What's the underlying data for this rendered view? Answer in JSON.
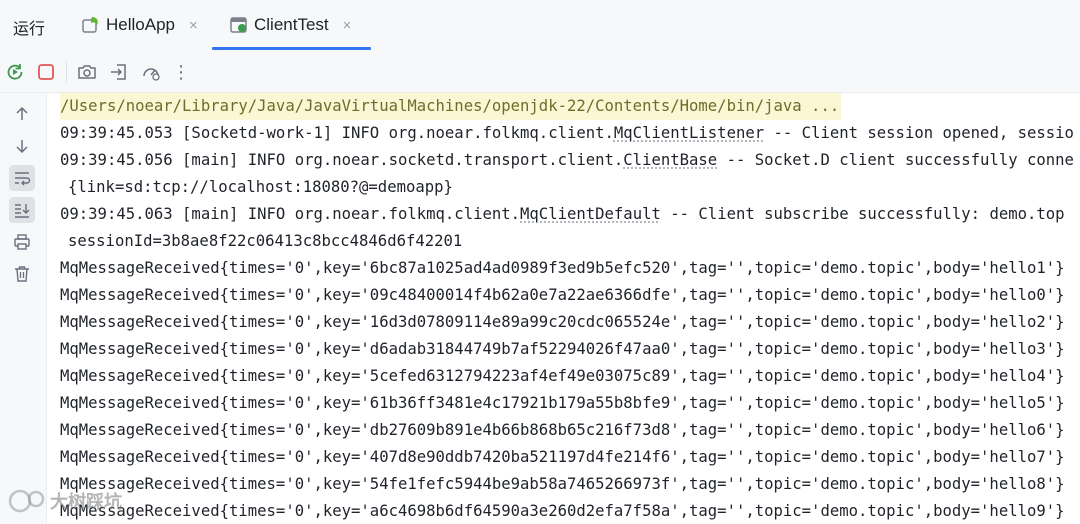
{
  "tabbar": {
    "run_label": "运行",
    "tabs": [
      {
        "label": "HelloApp",
        "close": "×",
        "active": false
      },
      {
        "label": "ClientTest",
        "close": "×",
        "active": true
      }
    ]
  },
  "toolbar": {
    "more": "⋮"
  },
  "console": {
    "command": "/Users/noear/Library/Java/JavaVirtualMachines/openjdk-22/Contents/Home/bin/java ...",
    "log1": {
      "prefix": "09:39:45.053 [Socketd-work-1] INFO org.noear.folkmq.client.",
      "cls": "MqClientListener",
      "suffix": " -- Client session opened, sessio"
    },
    "log2": {
      "prefix": "09:39:45.056 [main] INFO org.noear.socketd.transport.client.",
      "cls": "ClientBase",
      "suffix": " -- Socket.D client successfully conne"
    },
    "log2_cont": "{link=sd:tcp://localhost:18080?@=demoapp}",
    "log3": {
      "prefix": "09:39:45.063 [main] INFO org.noear.folkmq.client.",
      "cls": "MqClientDefault",
      "suffix": " -- Client subscribe successfully: demo.top"
    },
    "log3_cont": "sessionId=3b8ae8f22c06413c8bcc4846d6f42201",
    "messages": [
      "MqMessageReceived{times='0',key='6bc87a1025ad4ad0989f3ed9b5efc520',tag='',topic='demo.topic',body='hello1'}",
      "MqMessageReceived{times='0',key='09c48400014f4b62a0e7a22ae6366dfe',tag='',topic='demo.topic',body='hello0'}",
      "MqMessageReceived{times='0',key='16d3d07809114e89a99c20cdc065524e',tag='',topic='demo.topic',body='hello2'}",
      "MqMessageReceived{times='0',key='d6adab31844749b7af52294026f47aa0',tag='',topic='demo.topic',body='hello3'}",
      "MqMessageReceived{times='0',key='5cefed6312794223af4ef49e03075c89',tag='',topic='demo.topic',body='hello4'}",
      "MqMessageReceived{times='0',key='61b36ff3481e4c17921b179a55b8bfe9',tag='',topic='demo.topic',body='hello5'}",
      "MqMessageReceived{times='0',key='db27609b891e4b66b868b65c216f73d8',tag='',topic='demo.topic',body='hello6'}",
      "MqMessageReceived{times='0',key='407d8e90ddb7420ba521197d4fe214f6',tag='',topic='demo.topic',body='hello7'}",
      "MqMessageReceived{times='0',key='54fe1fefc5944be9ab58a7465266973f',tag='',topic='demo.topic',body='hello8'}",
      "MqMessageReceived{times='0',key='a6c4698b6df64590a3e260d2efa7f58a',tag='',topic='demo.topic',body='hello9'}"
    ]
  },
  "watermark": {
    "text": "大树踩坑"
  },
  "colors": {
    "accent": "#3574f0",
    "stop": "#e55757",
    "rerun": "#3d9a50",
    "command_bg": "#fbf6d3"
  }
}
